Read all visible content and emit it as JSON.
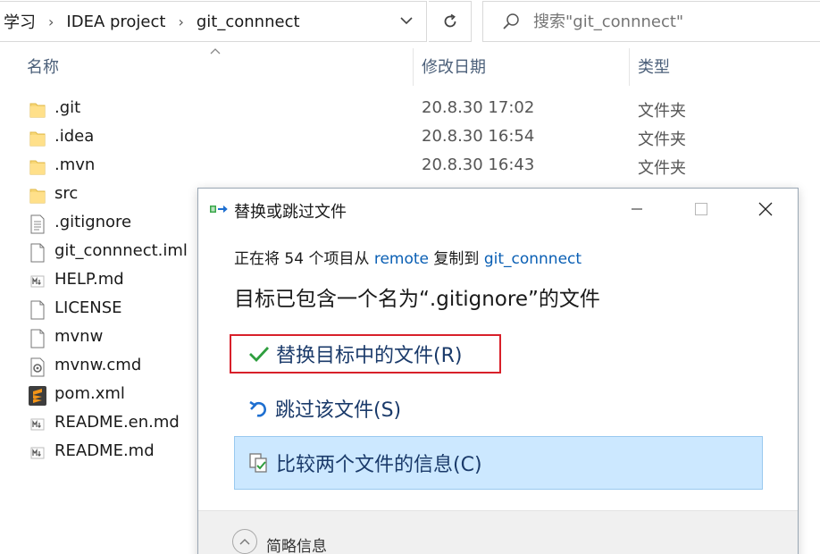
{
  "address_bar": {
    "crumbs": [
      "学习",
      "IDEA project",
      "git_connnect"
    ],
    "search_placeholder": "搜索\"git_connnect\""
  },
  "columns": {
    "name": "名称",
    "date": "修改日期",
    "type": "类型"
  },
  "files": [
    {
      "name": ".git",
      "date": "20.8.30 17:02",
      "type": "文件夹",
      "icon": "folder-icon"
    },
    {
      "name": ".idea",
      "date": "20.8.30 16:54",
      "type": "文件夹",
      "icon": "folder-icon"
    },
    {
      "name": ".mvn",
      "date": "20.8.30 16:43",
      "type": "文件夹",
      "icon": "folder-icon"
    },
    {
      "name": "src",
      "date": "",
      "type": "",
      "icon": "folder-icon"
    },
    {
      "name": ".gitignore",
      "date": "",
      "type": "",
      "icon": "text-file-icon"
    },
    {
      "name": "git_connnect.iml",
      "date": "",
      "type": "",
      "icon": "blank-file-icon"
    },
    {
      "name": "HELP.md",
      "date": "",
      "type": "",
      "icon": "markdown-file-icon"
    },
    {
      "name": "LICENSE",
      "date": "",
      "type": "",
      "icon": "blank-file-icon"
    },
    {
      "name": "mvnw",
      "date": "",
      "type": "",
      "icon": "blank-file-icon"
    },
    {
      "name": "mvnw.cmd",
      "date": "",
      "type": "",
      "icon": "cmd-file-icon"
    },
    {
      "name": "pom.xml",
      "date": "",
      "type": "",
      "icon": "sublime-file-icon"
    },
    {
      "name": "README.en.md",
      "date": "",
      "type": "",
      "icon": "markdown-file-icon"
    },
    {
      "name": "README.md",
      "date": "",
      "type": "",
      "icon": "markdown-file-icon"
    }
  ],
  "dialog": {
    "title": "替换或跳过文件",
    "copy_prefix": "正在将 54 个项目从 ",
    "copy_source": "remote",
    "copy_middle": " 复制到 ",
    "copy_dest": "git_connnect",
    "headline": "目标已包含一个名为“.gitignore”的文件",
    "replace_label": "替换目标中的文件(R)",
    "skip_label": "跳过该文件(S)",
    "compare_label": "比较两个文件的信息(C)",
    "details_label": "简略信息"
  },
  "colors": {
    "accent_link": "#0a5fb4",
    "highlight_border": "#d8202a",
    "selected_bg": "#cce8ff",
    "check_green": "#2e9e3e"
  }
}
